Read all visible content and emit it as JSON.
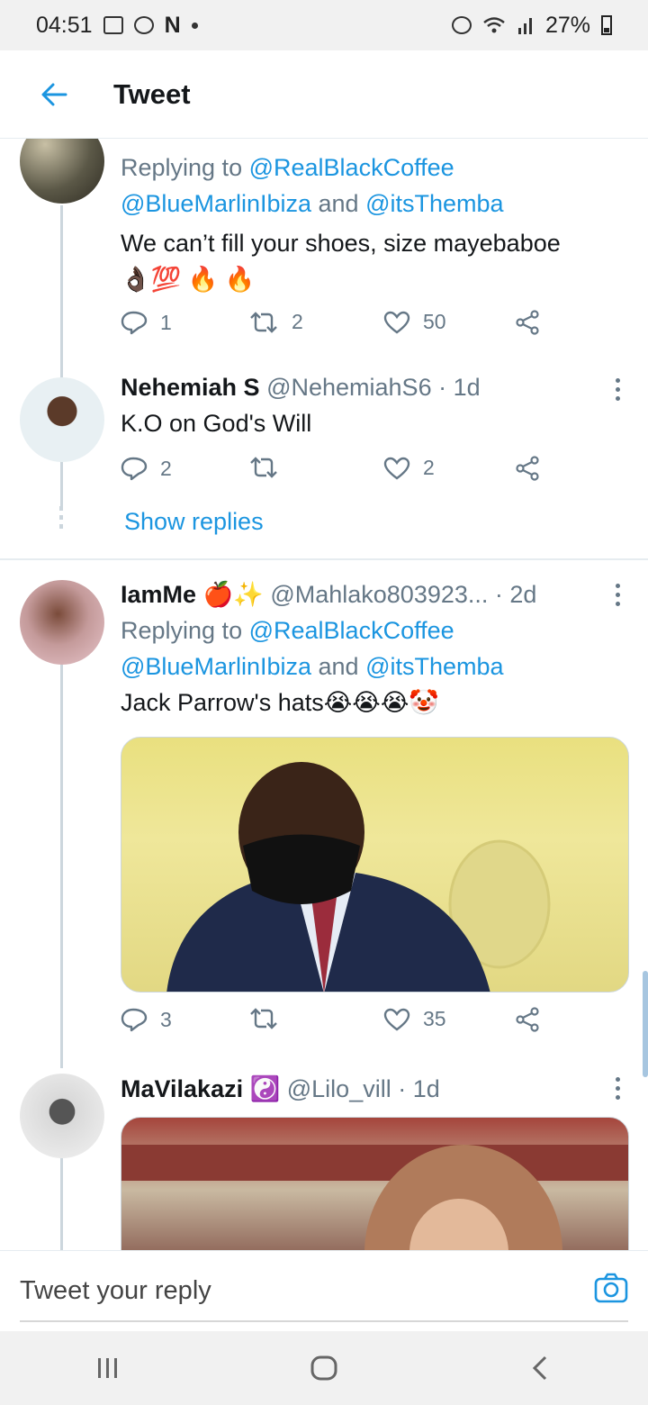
{
  "status_bar": {
    "time": "04:51",
    "notif_letter": "N",
    "battery_pct": "27%"
  },
  "app_bar": {
    "title": "Tweet"
  },
  "tweets": [
    {
      "avatar": "patterned-avatar",
      "reply_to": {
        "prefix": "Replying to",
        "h1": "@RealBlackCoffee",
        "h2": "@BlueMarlinIbiza",
        "and": "and",
        "h3": "@itsThemba"
      },
      "text": "We can’t fill your shoes, size mayebaboe",
      "emoji": "👌🏿💯 🔥 🔥",
      "replies": "1",
      "retweets": "2",
      "likes": "50"
    },
    {
      "avatar": "nehemiah-avatar",
      "name": "Nehemiah S",
      "handle": "@NehemiahS6 · 1d",
      "text": "K.O on God's Will",
      "replies": "2",
      "retweets": "",
      "likes": "2",
      "show_replies": "Show replies"
    },
    {
      "avatar": "iamme-avatar",
      "name": "IamMe",
      "name_emoji": "🍎✨",
      "handle": "@Mahlako803923...",
      "time": "· 2d",
      "reply_to": {
        "prefix": "Replying to",
        "h1": "@RealBlackCoffee",
        "h2": "@BlueMarlinIbiza",
        "and": "and",
        "h3": "@itsThemba"
      },
      "text": "Jack Parrow's hats",
      "emoji": "😭😭😭🤡",
      "replies": "3",
      "retweets": "",
      "likes": "35"
    },
    {
      "avatar": "mavilakazi-avatar",
      "name": "MaVilakazi",
      "name_emoji": "☯️",
      "handle": "@Lilo_vill · 1d"
    }
  ],
  "reply_bar": {
    "placeholder": "Tweet your reply"
  },
  "colors": {
    "link": "#1b95e0",
    "muted": "#657786"
  }
}
